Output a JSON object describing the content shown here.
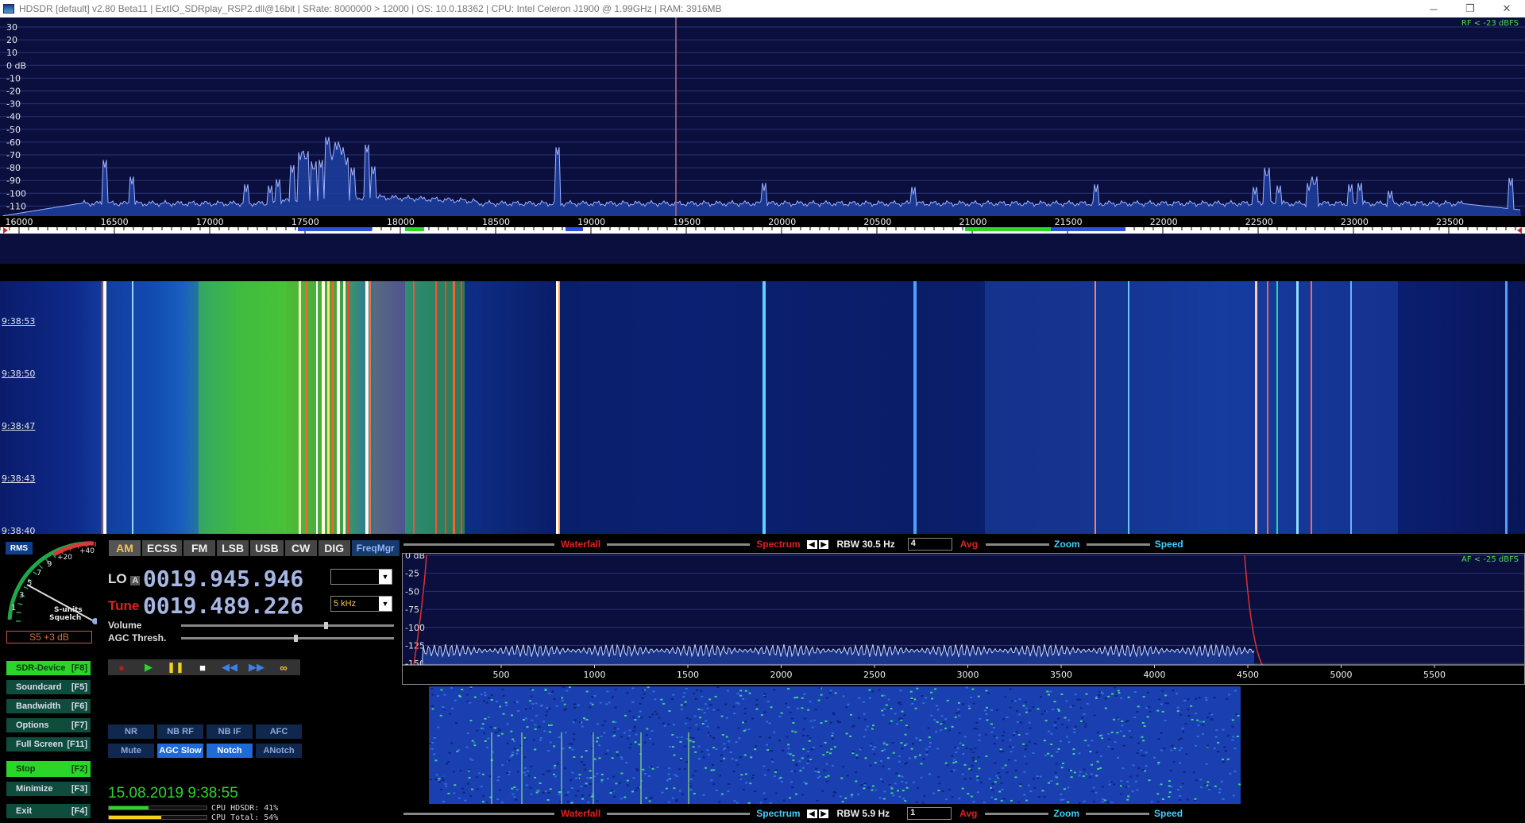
{
  "titlebar": {
    "title": "HDSDR  [default]  v2.80 Beta11  |  ExtIO_SDRplay_RSP2.dll@16bit  |  SRate: 8000000 > 12000  |  OS: 10.0.18362   |  CPU: Intel Celeron  J1900  @ 1.99GHz  |  RAM: 3916MB",
    "minimize": "─",
    "restore": "❐",
    "close": "✕"
  },
  "rf_spectrum": {
    "db_labels": [
      "30",
      "20",
      "10",
      "0 dB",
      "-10",
      "-20",
      "-30",
      "-40",
      "-50",
      "-60",
      "-70",
      "-80",
      "-90",
      "-100",
      "-110"
    ],
    "freq_labels": [
      "16000",
      "16500",
      "17000",
      "17500",
      "18000",
      "18500",
      "19000",
      "19500",
      "20000",
      "20500",
      "21000",
      "21500",
      "22000",
      "22500",
      "23000",
      "23500"
    ],
    "level_text": "RF < -23 dBFS",
    "trace_color": "#ffffff",
    "fill_color": "#1d3ea0"
  },
  "rf_waterfall": {
    "times": [
      "9:38:53",
      "9:38:50",
      "9:38:47",
      "9:38:43",
      "9:38:40"
    ]
  },
  "smeter": {
    "mode_label": "RMS",
    "scale": [
      "1",
      "3",
      "5",
      "7",
      "9",
      "+20",
      "+40"
    ],
    "units_label": "S-units",
    "squelch_label": "Squelch",
    "readout": "S5 +3 dB"
  },
  "left_buttons": [
    {
      "label": "SDR-Device",
      "key": "[F8]"
    },
    {
      "label": "Soundcard",
      "key": "[F5]"
    },
    {
      "label": "Bandwidth",
      "key": "[F6]"
    },
    {
      "label": "Options",
      "key": "[F7]"
    },
    {
      "label": "Full Screen",
      "key": "[F11]"
    },
    {
      "label": "Stop",
      "key": "[F2]"
    },
    {
      "label": "Minimize",
      "key": "[F3]"
    },
    {
      "label": "Exit",
      "key": "[F4]"
    }
  ],
  "modes": [
    "AM",
    "ECSS",
    "FM",
    "LSB",
    "USB",
    "CW",
    "DIG",
    "FreqMgr"
  ],
  "lo": {
    "label": "LO",
    "sub": "A",
    "freq": "0019.945.946",
    "dropdown": ""
  },
  "tune": {
    "label": "Tune",
    "freq": "0019.489.226",
    "dropdown": "5 kHz"
  },
  "volume_label": "Volume",
  "agc_label": "AGC Thresh.",
  "dsp": {
    "nr": "NR",
    "nbrf": "NB RF",
    "nbif": "NB IF",
    "afc": "AFC",
    "mute": "Mute",
    "agcslow": "AGC Slow",
    "notch": "Notch",
    "anotch": "ANotch"
  },
  "datetime": "15.08.2019 9:38:55",
  "cpu": {
    "hdsdr_text": "CPU HDSDR:  41%",
    "total_text": "CPU Total:  54%",
    "hdsdr_pct": 41,
    "total_pct": 54
  },
  "af_toolbar_top": {
    "waterfall": "Waterfall",
    "spectrum": "Spectrum",
    "rbw": "RBW 30.5 Hz",
    "avg_value": "4",
    "avg": "Avg",
    "zoom": "Zoom",
    "speed": "Speed"
  },
  "af_toolbar_bot": {
    "waterfall": "Waterfall",
    "spectrum": "Spectrum",
    "rbw": "RBW  5.9 Hz",
    "avg_value": "1",
    "avg": "Avg",
    "zoom": "Zoom",
    "speed": "Speed"
  },
  "af_spectrum": {
    "db_labels": [
      "0 dB",
      "-25",
      "-50",
      "-75",
      "-100",
      "-125",
      "-150"
    ],
    "freq_labels": [
      "500",
      "1000",
      "1500",
      "2000",
      "2500",
      "3000",
      "3500",
      "4000",
      "4500",
      "5000",
      "5500"
    ],
    "level_text": "AF < -25 dBFS"
  },
  "colors": {
    "green_text": "#2ad62a",
    "label_red": "#e02020",
    "label_cyan": "#3fd0ff",
    "digits": "#a7b6e3",
    "amber": "#f2c25a"
  }
}
